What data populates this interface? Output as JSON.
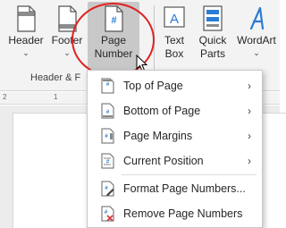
{
  "ribbon": {
    "header_label": "Header",
    "footer_label": "Footer",
    "page_number_line1": "Page",
    "page_number_line2": "Number",
    "text_box_line1": "Text",
    "text_box_line2": "Box",
    "quick_parts_line1": "Quick",
    "quick_parts_line2": "Parts",
    "wordart_label": "WordArt",
    "group_label": "Header & F",
    "chevron": "⌄"
  },
  "ruler": {
    "ticks": [
      "2",
      "1"
    ]
  },
  "menu": {
    "items": [
      {
        "label": "Top of Page",
        "icon": "page-top-number-icon",
        "submenu_arrow": "›"
      },
      {
        "label": "Bottom of Page",
        "icon": "page-bottom-number-icon",
        "submenu_arrow": "›"
      },
      {
        "label": "Page Margins",
        "icon": "page-margins-number-icon",
        "submenu_arrow": "›"
      },
      {
        "label": "Current Position",
        "icon": "current-position-number-icon",
        "submenu_arrow": "›"
      },
      {
        "label": "Format Page Numbers...",
        "icon": "format-page-numbers-icon"
      },
      {
        "label": "Remove Page Numbers",
        "icon": "remove-page-numbers-icon"
      }
    ]
  },
  "colors": {
    "highlight_circle": "#e02020",
    "icon_blue": "#2b7cd3",
    "remove_red": "#d13438"
  }
}
